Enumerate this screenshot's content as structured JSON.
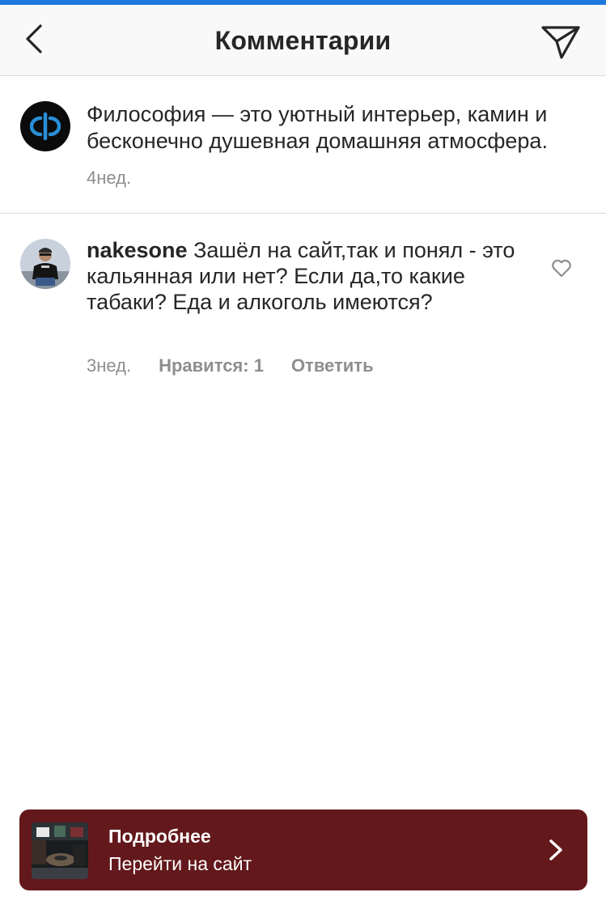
{
  "header": {
    "title": "Комментарии"
  },
  "caption": {
    "text": "Философия — это уютный интерьер, камин и бесконечно душевная домашняя атмосфера.",
    "time": "4нед."
  },
  "comments": [
    {
      "username": "nakesone",
      "text": " Зашёл на сайт,так и понял - это кальянная или нет? Если да,то какие табаки? Еда и алкоголь имеются?",
      "time": "3нед.",
      "likes_label": "Нравится: 1",
      "reply_label": "Ответить"
    }
  ],
  "promo": {
    "title": "Подробнее",
    "subtitle": "Перейти на сайт"
  },
  "colors": {
    "accent_bar": "#1f7ae0",
    "promo_bg": "#63181b",
    "logo_blue": "#2a8fd6",
    "muted_text": "#8e8e8e"
  }
}
